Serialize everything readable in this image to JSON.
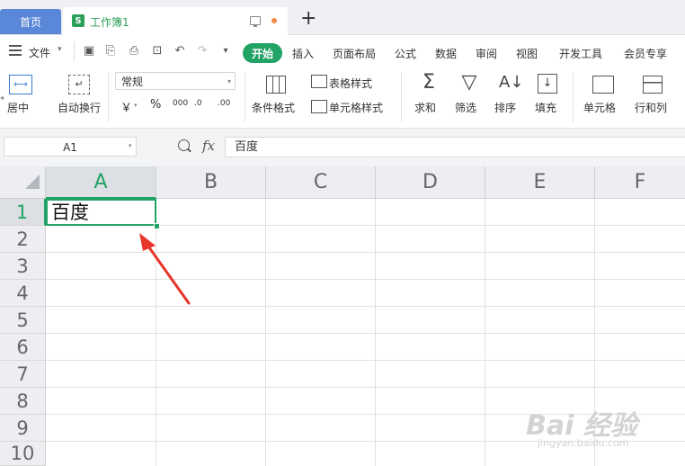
{
  "tabs": {
    "home": "首页",
    "document": "工作簿1"
  },
  "menu": {
    "file": "文件",
    "start": "开始",
    "items": [
      "插入",
      "页面布局",
      "公式",
      "数据",
      "审阅",
      "视图",
      "开发工具",
      "会员专享"
    ]
  },
  "ribbon": {
    "merge_center": "居中",
    "wrap_text": "自动换行",
    "number_format": "常规",
    "currency": "￥",
    "percent": "%",
    "thousands": "000",
    "inc_decimal": ".0",
    "dec_decimal": ".00",
    "conditional_format": "条件格式",
    "table_style": "表格样式",
    "cell_style": "单元格样式",
    "sum": "求和",
    "filter": "筛选",
    "sort": "排序",
    "fill": "填充",
    "cell": "单元格",
    "row_col": "行和列"
  },
  "formula_bar": {
    "name_box": "A1",
    "fx": "fx",
    "content": "百度"
  },
  "columns": [
    "A",
    "B",
    "C",
    "D",
    "E",
    "F"
  ],
  "rows": [
    "1",
    "2",
    "3",
    "4",
    "5",
    "6",
    "7",
    "8",
    "9",
    "10"
  ],
  "cells": {
    "A1": "百度"
  },
  "watermark": {
    "main": "Bai 经验",
    "sub": "jingyan.baidu.com"
  },
  "colors": {
    "accent": "#21a366",
    "home_tab": "#5b87d8",
    "arrow": "#e8352b"
  }
}
